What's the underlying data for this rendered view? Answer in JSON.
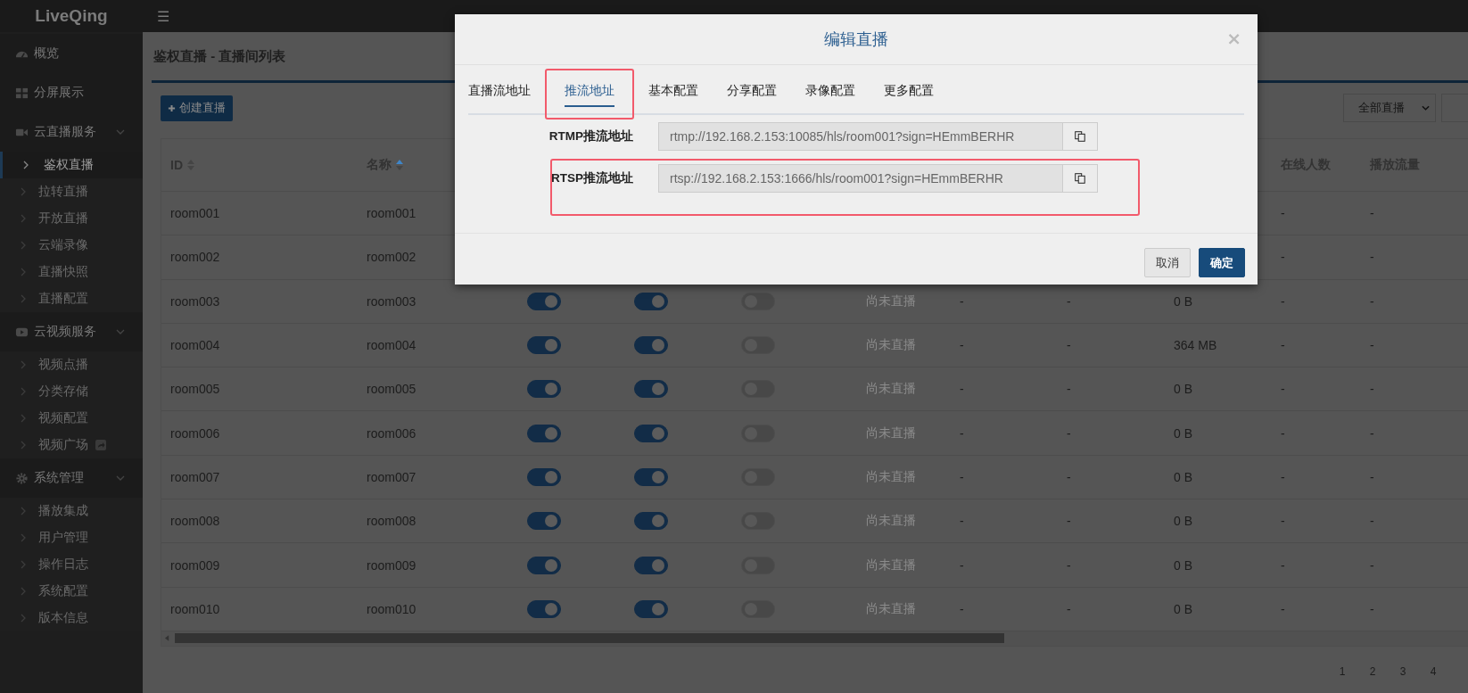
{
  "topbar": {
    "logo": "LiveQing",
    "menu_glyph": "☰"
  },
  "sidebar": {
    "items": [
      {
        "label": "概览"
      },
      {
        "label": "分屏展示"
      },
      {
        "label": "云直播服务",
        "expanded": true,
        "children": [
          {
            "label": "鉴权直播",
            "selected": true,
            "external": false
          },
          {
            "label": "拉转直播",
            "selected": false,
            "external": false
          },
          {
            "label": "开放直播",
            "selected": false,
            "external": false
          },
          {
            "label": "云端录像",
            "selected": false,
            "external": false
          },
          {
            "label": "直播快照",
            "selected": false,
            "external": false
          },
          {
            "label": "直播配置",
            "selected": false,
            "external": false
          }
        ]
      },
      {
        "label": "云视频服务",
        "expanded": true,
        "children": [
          {
            "label": "视频点播",
            "selected": false,
            "external": false
          },
          {
            "label": "分类存储",
            "selected": false,
            "external": false
          },
          {
            "label": "视频配置",
            "selected": false,
            "external": false
          },
          {
            "label": "视频广场",
            "selected": false,
            "external": true
          }
        ]
      },
      {
        "label": "系统管理",
        "expanded": true,
        "children": [
          {
            "label": "播放集成",
            "selected": false,
            "external": false
          },
          {
            "label": "用户管理",
            "selected": false,
            "external": false
          },
          {
            "label": "操作日志",
            "selected": false,
            "external": false
          },
          {
            "label": "系统配置",
            "selected": false,
            "external": false
          },
          {
            "label": "版本信息",
            "selected": false,
            "external": false
          }
        ]
      }
    ]
  },
  "page": {
    "title": "鉴权直播 - 直播间列表",
    "create_button": "创建直播",
    "filter": "全部直播"
  },
  "table": {
    "columns": [
      {
        "label": "ID",
        "sortable": true,
        "sorted_ascending": false
      },
      {
        "label": "名称",
        "sortable": true,
        "sorted_ascending": true
      },
      {
        "label": "在线人数"
      },
      {
        "label": "播放流量"
      }
    ],
    "rows": [
      {
        "id": "room001",
        "name": "room001",
        "online": "-",
        "flow": "-"
      },
      {
        "id": "room002",
        "name": "room002",
        "online": "-",
        "flow": "-"
      },
      {
        "id": "room003",
        "name": "room003",
        "switch_1": true,
        "switch_2": true,
        "switch_3": false,
        "status": "尚未直播",
        "column_7": "-",
        "column_8": "-",
        "column_9": "0 B",
        "online": "-",
        "flow": "-"
      },
      {
        "id": "room004",
        "name": "room004",
        "switch_1": true,
        "switch_2": true,
        "switch_3": false,
        "status": "尚未直播",
        "column_7": "-",
        "column_8": "-",
        "column_9": "364 MB",
        "online": "-",
        "flow": "-"
      },
      {
        "id": "room005",
        "name": "room005",
        "switch_1": true,
        "switch_2": true,
        "switch_3": false,
        "status": "尚未直播",
        "column_7": "-",
        "column_8": "-",
        "column_9": "0 B",
        "online": "-",
        "flow": "-"
      },
      {
        "id": "room006",
        "name": "room006",
        "switch_1": true,
        "switch_2": true,
        "switch_3": false,
        "status": "尚未直播",
        "column_7": "-",
        "column_8": "-",
        "column_9": "0 B",
        "online": "-",
        "flow": "-"
      },
      {
        "id": "room007",
        "name": "room007",
        "switch_1": true,
        "switch_2": true,
        "switch_3": false,
        "status": "尚未直播",
        "column_7": "-",
        "column_8": "-",
        "column_9": "0 B",
        "online": "-",
        "flow": "-"
      },
      {
        "id": "room008",
        "name": "room008",
        "switch_1": true,
        "switch_2": true,
        "switch_3": false,
        "status": "尚未直播",
        "column_7": "-",
        "column_8": "-",
        "column_9": "0 B",
        "online": "-",
        "flow": "-"
      },
      {
        "id": "room009",
        "name": "room009",
        "switch_1": true,
        "switch_2": true,
        "switch_3": false,
        "status": "尚未直播",
        "column_7": "-",
        "column_8": "-",
        "column_9": "0 B",
        "online": "-",
        "flow": "-"
      },
      {
        "id": "room010",
        "name": "room010",
        "switch_1": true,
        "switch_2": true,
        "switch_3": false,
        "status": "尚未直播",
        "column_7": "-",
        "column_8": "-",
        "column_9": "0 B",
        "online": "-",
        "flow": "-"
      }
    ]
  },
  "pagination": {
    "pages": [
      "1",
      "2",
      "3",
      "4"
    ]
  },
  "modal": {
    "title": "编辑直播",
    "close": "×",
    "tabs": [
      {
        "label": "直播流地址",
        "selected": false,
        "highlighted": false
      },
      {
        "label": "推流地址",
        "selected": true,
        "highlighted": true
      },
      {
        "label": "基本配置",
        "selected": false,
        "highlighted": false
      },
      {
        "label": "分享配置",
        "selected": false,
        "highlighted": false
      },
      {
        "label": "录像配置",
        "selected": false,
        "highlighted": false
      },
      {
        "label": "更多配置",
        "selected": false,
        "highlighted": false
      }
    ],
    "fields": [
      {
        "label": "RTMP推流地址",
        "value": "rtmp://192.168.2.153:10085/hls/room001?sign=HEmmBERHR",
        "highlighted": false
      },
      {
        "label": "RTSP推流地址",
        "value": "rtsp://192.168.2.153:1666/hls/room001?sign=HEmmBERHR",
        "highlighted": true
      }
    ],
    "buttons": [
      {
        "label": "取消",
        "kind": "default"
      },
      {
        "label": "确定",
        "kind": "primary"
      }
    ]
  }
}
